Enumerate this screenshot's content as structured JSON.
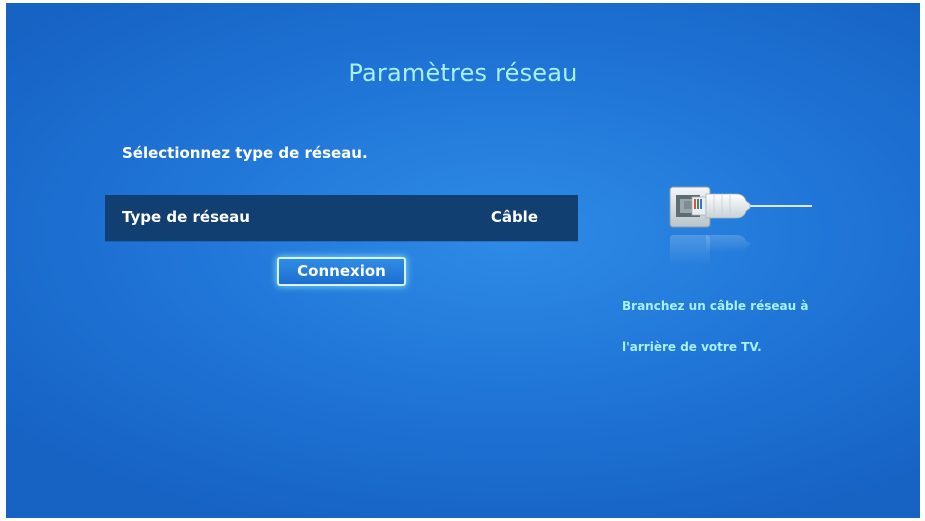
{
  "page_title": "Paramètres réseau",
  "prompt": "Sélectionnez type de réseau.",
  "network_type": {
    "label": "Type de réseau",
    "value": "Câble"
  },
  "connect_button": "Connexion",
  "hint": {
    "line1": "Branchez un câble réseau à",
    "line2": "l'arrière de votre TV."
  },
  "colors": {
    "background": "#1f74d6",
    "title": "#a8f1f8",
    "selected_row": "#123f72",
    "hint_text": "#a8f1f8"
  },
  "icons": [
    "ethernet-cable-icon"
  ]
}
